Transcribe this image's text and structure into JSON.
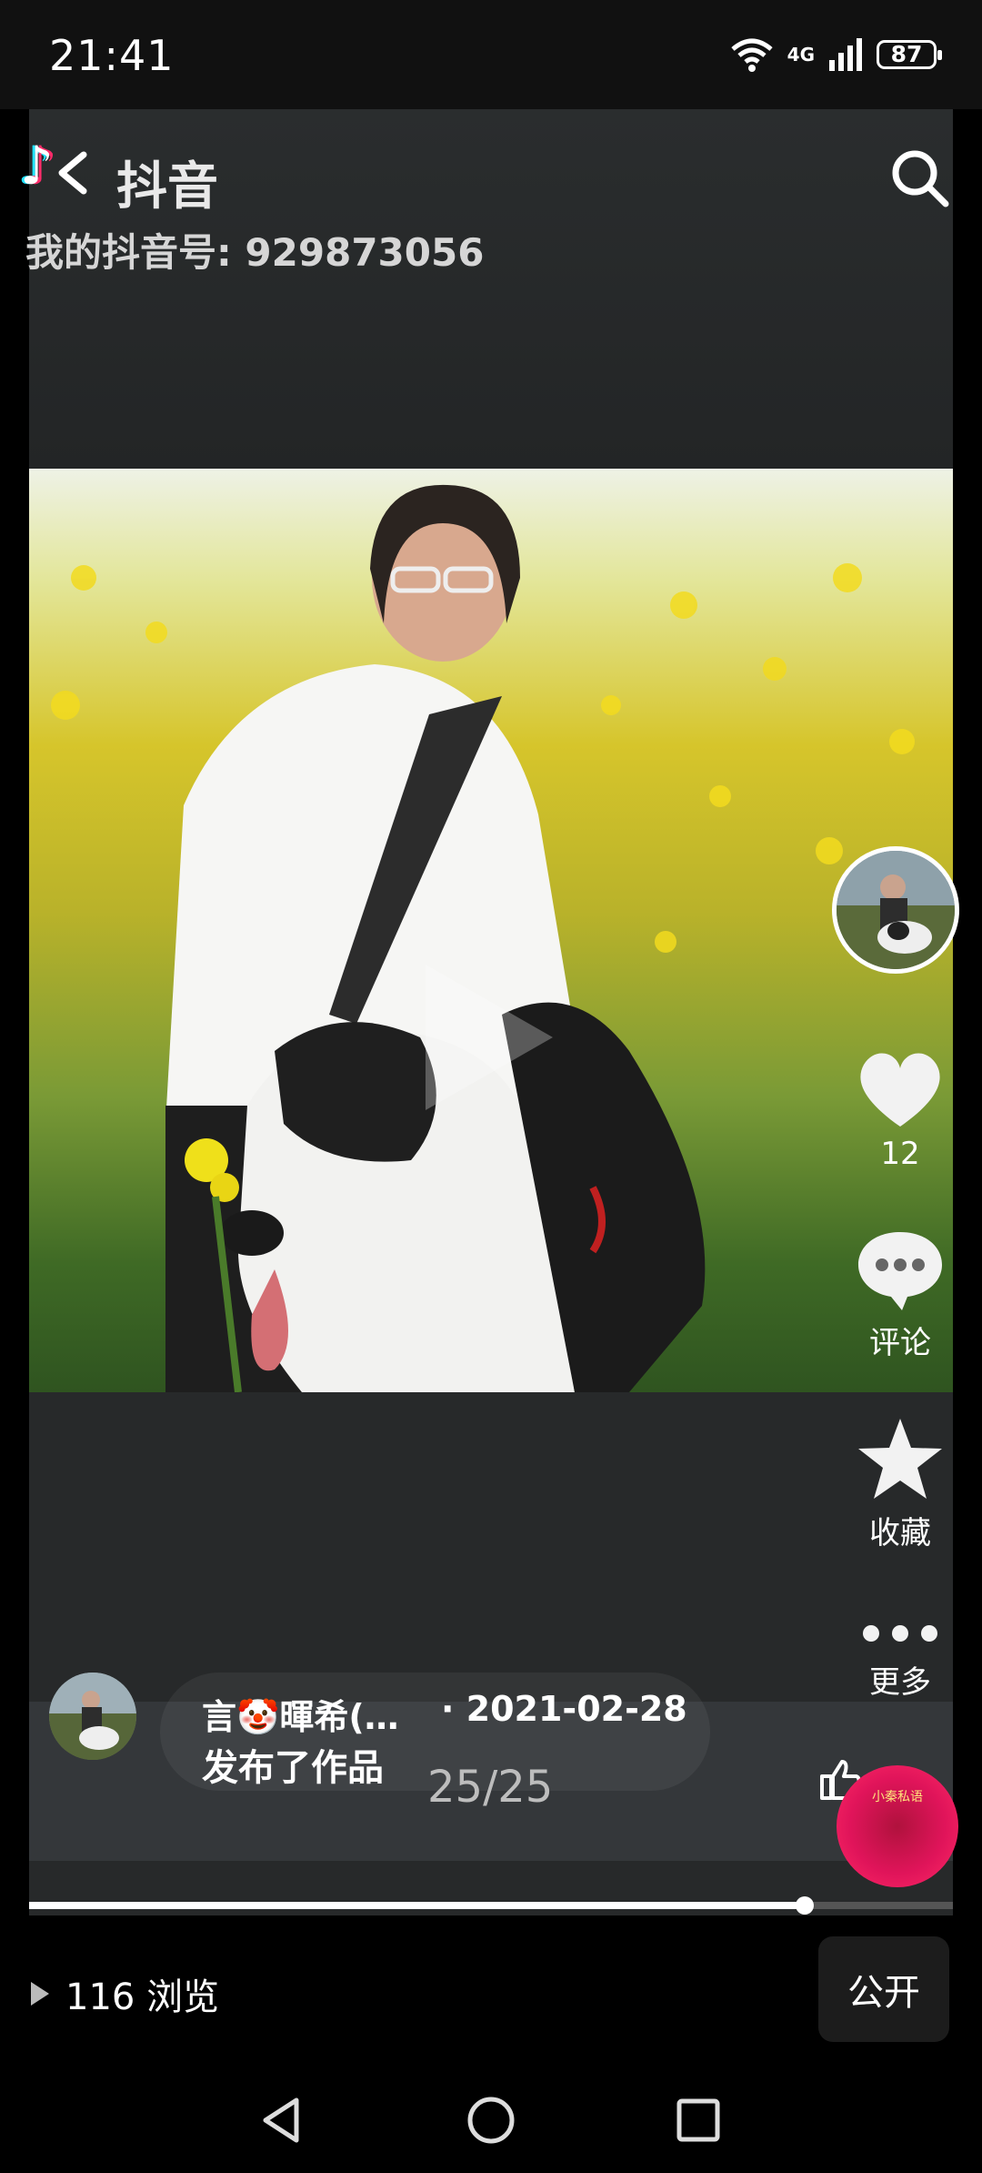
{
  "status_bar": {
    "time": "21:41",
    "network": "4G",
    "battery": "87"
  },
  "watermark": {
    "app_name": "抖音",
    "user_id_text": "我的抖音号: 929873056"
  },
  "actions": {
    "like_count": "12",
    "comment_label": "评论",
    "favorite_label": "收藏",
    "more_label": "更多"
  },
  "post": {
    "author": "言🤡暉希(…",
    "date": "· 2021-02-28",
    "action_text": "发布了作品",
    "page_counter": "25/25"
  },
  "music": {
    "disc_text": "小秦私语"
  },
  "progress": {
    "fraction": 0.84
  },
  "footer": {
    "views": "116 浏览",
    "public_button": "公开"
  },
  "colors": {
    "accent_pink": "#ff2b6a",
    "accent_cyan": "#20e3ff",
    "music_disc": "#e0145a"
  },
  "icons": [
    "back-icon",
    "search-icon",
    "play-icon",
    "heart-icon",
    "comment-icon",
    "star-icon",
    "more-dots-icon",
    "thumb-up-icon",
    "triangle-play-icon",
    "nav-back-icon",
    "nav-home-icon",
    "nav-recents-icon"
  ]
}
